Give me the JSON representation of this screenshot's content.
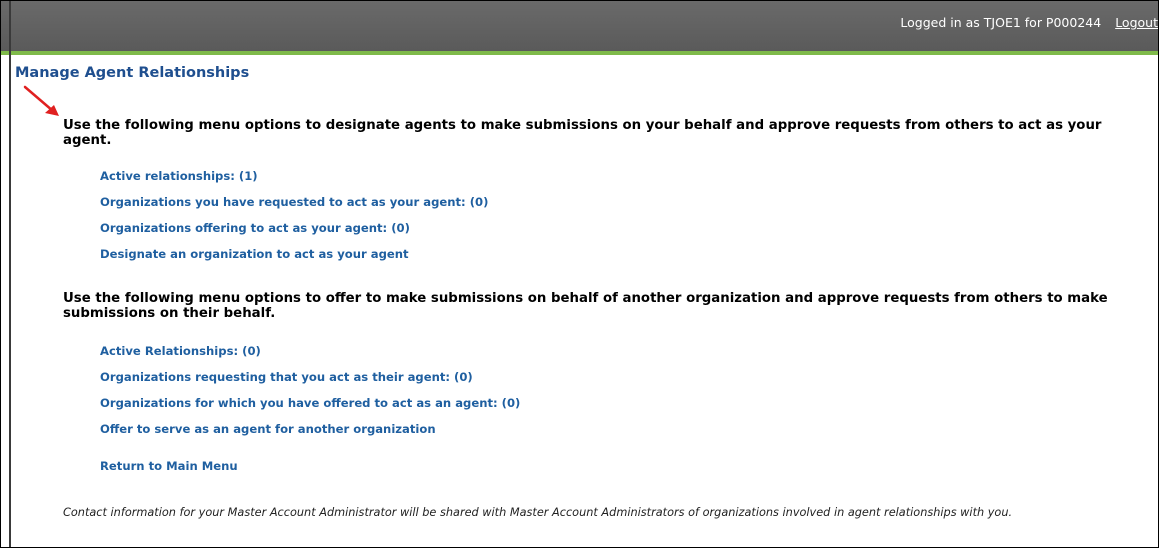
{
  "header": {
    "logged_in_text": "Logged in as TJOE1 for P000244",
    "logout_label": "Logout"
  },
  "page_title": "Manage Agent Relationships",
  "sections": [
    {
      "heading": "Use the following menu options to designate agents to make submissions on your behalf and approve requests from others to act as your agent.",
      "items": [
        {
          "label": "Active relationships: (1)"
        },
        {
          "label": "Organizations you have requested to act as your agent: (0)"
        },
        {
          "label": "Organizations offering to act as your agent: (0)"
        },
        {
          "label": "Designate an organization to act as your agent"
        }
      ]
    },
    {
      "heading": "Use the following menu options to offer to make submissions on behalf of another organization and approve requests from others to make submissions on their behalf.",
      "items": [
        {
          "label": "Active Relationships: (0)"
        },
        {
          "label": "Organizations requesting that you act as their agent: (0)"
        },
        {
          "label": "Organizations for which you have offered to act as an agent: (0)"
        },
        {
          "label": "Offer to serve as an agent for another organization"
        }
      ]
    }
  ],
  "return_label": "Return to Main Menu",
  "footnote": "Contact information for your Master Account Administrator will be shared with Master Account Administrators of organizations involved in agent relationships with you.",
  "colors": {
    "header_bg": "#5f5f5f",
    "header_accent": "#7fba4a",
    "link": "#1f5fa0",
    "title": "#1f4f8f",
    "annotation_arrow": "#e02020"
  },
  "icons": {
    "annotation": "red-arrow-icon"
  }
}
